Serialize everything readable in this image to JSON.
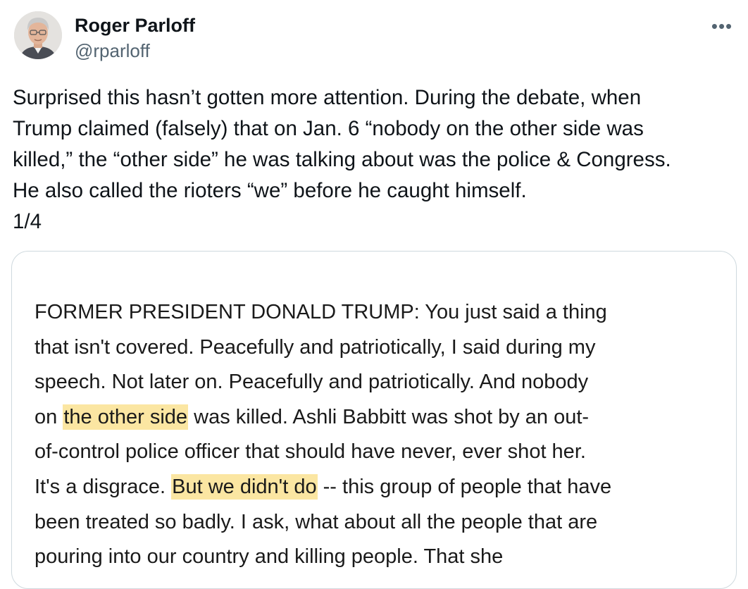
{
  "author": {
    "name": "Roger Parloff",
    "handle": "@rparloff",
    "avatar_icon": "profile-photo"
  },
  "more_icon": "more-horizontal-icon",
  "more_glyph": "•••",
  "tweet": {
    "lines": [
      "Surprised this hasn’t gotten more attention. During the debate, when",
      "Trump claimed (falsely) that on Jan. 6 “nobody on the other side was",
      "killed,” the “other side” he was talking about was the police & Congress.",
      "He also called the rioters “we” before he caught himself.",
      "1/4"
    ]
  },
  "media": {
    "highlight_color": "#fbe6a2",
    "lines": [
      {
        "segments": [
          {
            "text": "FORMER PRESIDENT DONALD TRUMP: You just said a thing"
          }
        ]
      },
      {
        "segments": [
          {
            "text": "that isn't covered. Peacefully and patriotically, I said during my"
          }
        ]
      },
      {
        "segments": [
          {
            "text": "speech. Not later on. Peacefully and patriotically. And nobody"
          }
        ]
      },
      {
        "segments": [
          {
            "text": "on "
          },
          {
            "text": "the other side",
            "highlight": true
          },
          {
            "text": " was killed. Ashli Babbitt was shot by an out-"
          }
        ]
      },
      {
        "segments": [
          {
            "text": "of-control police officer that should have never, ever shot her."
          }
        ]
      },
      {
        "segments": [
          {
            "text": "It's a disgrace. "
          },
          {
            "text": "But we didn't do",
            "highlight": true
          },
          {
            "text": " -- this group of people that have"
          }
        ]
      },
      {
        "segments": [
          {
            "text": "been treated so badly. I ask, what about all the people that are"
          }
        ]
      },
      {
        "segments": [
          {
            "text": "pouring into our country and killing people. That she"
          }
        ]
      }
    ]
  }
}
